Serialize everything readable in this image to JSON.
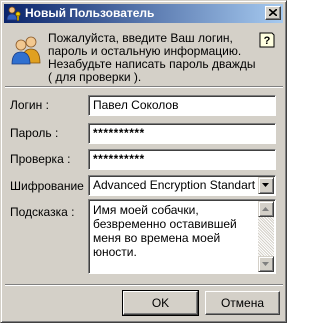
{
  "window": {
    "title": "Новый Пользователь",
    "icons": {
      "title": "user-key-icon",
      "close": "close-icon"
    }
  },
  "header": {
    "icon": "users-icon",
    "instruction": "Пожалуйста, введите Ваш логин, пароль и остальную информацию. Незабудьте написать пароль дважды ( для проверки ).",
    "help_icon": "help-icon"
  },
  "form": {
    "login": {
      "label": "Логин :",
      "value": "Павел Соколов"
    },
    "password": {
      "label": "Пароль :",
      "value": "**********"
    },
    "confirm": {
      "label": "Проверка :",
      "value": "**********"
    },
    "encryption": {
      "label": "Шифрование :",
      "value": "Advanced Encryption Standart"
    },
    "hint": {
      "label": "Подсказка :",
      "value": "Имя моей собачки, безвременно оставившей меня во времена моей юности."
    }
  },
  "buttons": {
    "ok": "OK",
    "cancel": "Отмена"
  },
  "colors": {
    "face": "#d4d0c8",
    "title_start": "#0a246a",
    "title_end": "#a6caf0"
  }
}
